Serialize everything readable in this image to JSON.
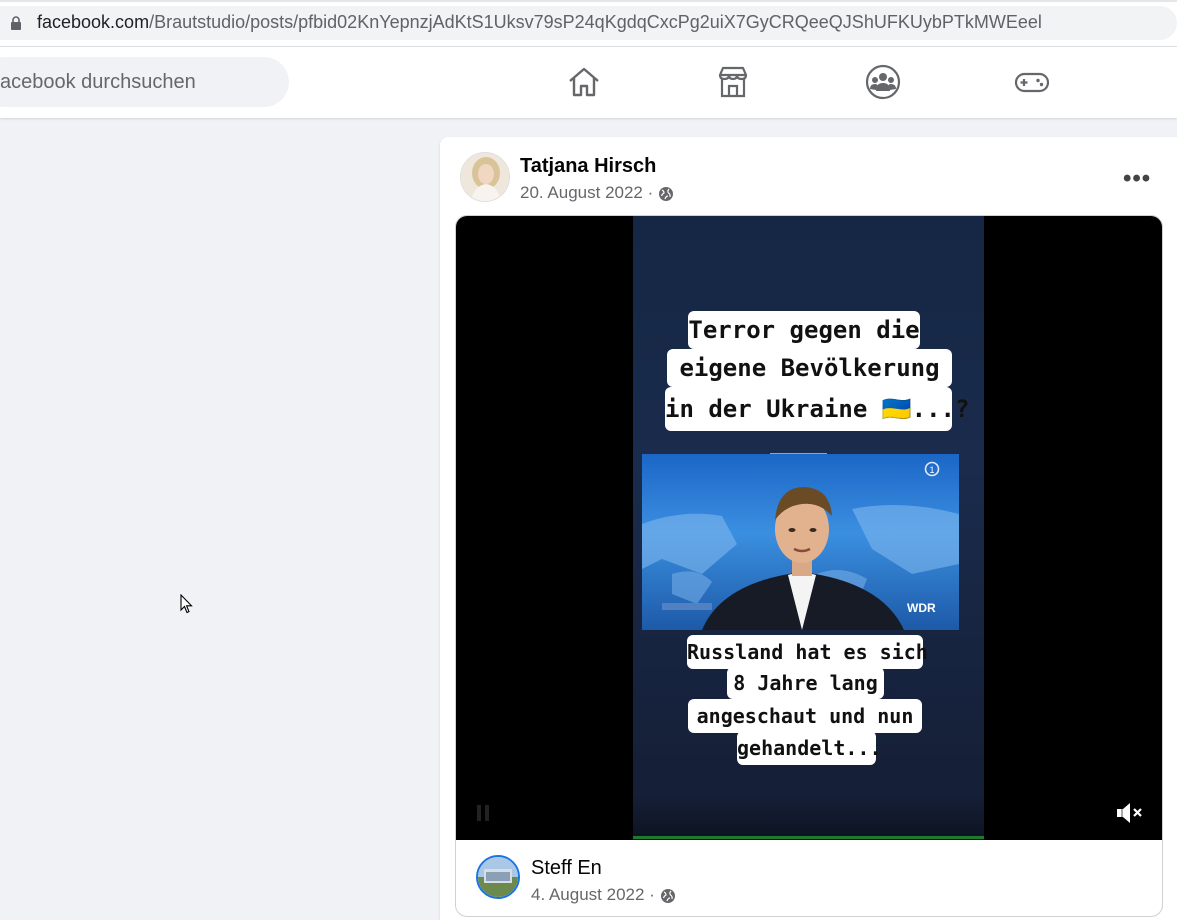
{
  "browser": {
    "url_domain": "facebook.com",
    "url_path": "/Brautstudio/posts/pfbid02KnYepnzjAdKtS1Uksv79sP24qKgdqCxcPg2uiX7GyCRQeeQJShUFKUybPTkMWEeel"
  },
  "facebook_header": {
    "search_placeholder": "acebook durchsuchen",
    "nav_icons": [
      "home-icon",
      "marketplace-icon",
      "groups-icon",
      "gaming-icon"
    ]
  },
  "post": {
    "author": "Tatjana Hirsch",
    "date": "20. August 2022 ·",
    "privacy_icon": "globe-icon",
    "more_label": "•••",
    "video": {
      "caption_top": [
        "Terror gegen die",
        "eigene Bevölkerung",
        "in der Ukraine 🇺🇦...?"
      ],
      "channel_label": "WDR",
      "caption_bottom": [
        "Russland hat es sich",
        "8 Jahre lang",
        "angeschaut und nun",
        "gehandelt..."
      ],
      "mute_icon": "muted-speaker-icon"
    },
    "shared_post": {
      "author": "Steff En",
      "date": "4. August 2022 ·"
    }
  },
  "colors": {
    "fb_background": "#f0f2f5",
    "accent_blue": "#1b74e4",
    "secondary_text": "#65676b"
  }
}
